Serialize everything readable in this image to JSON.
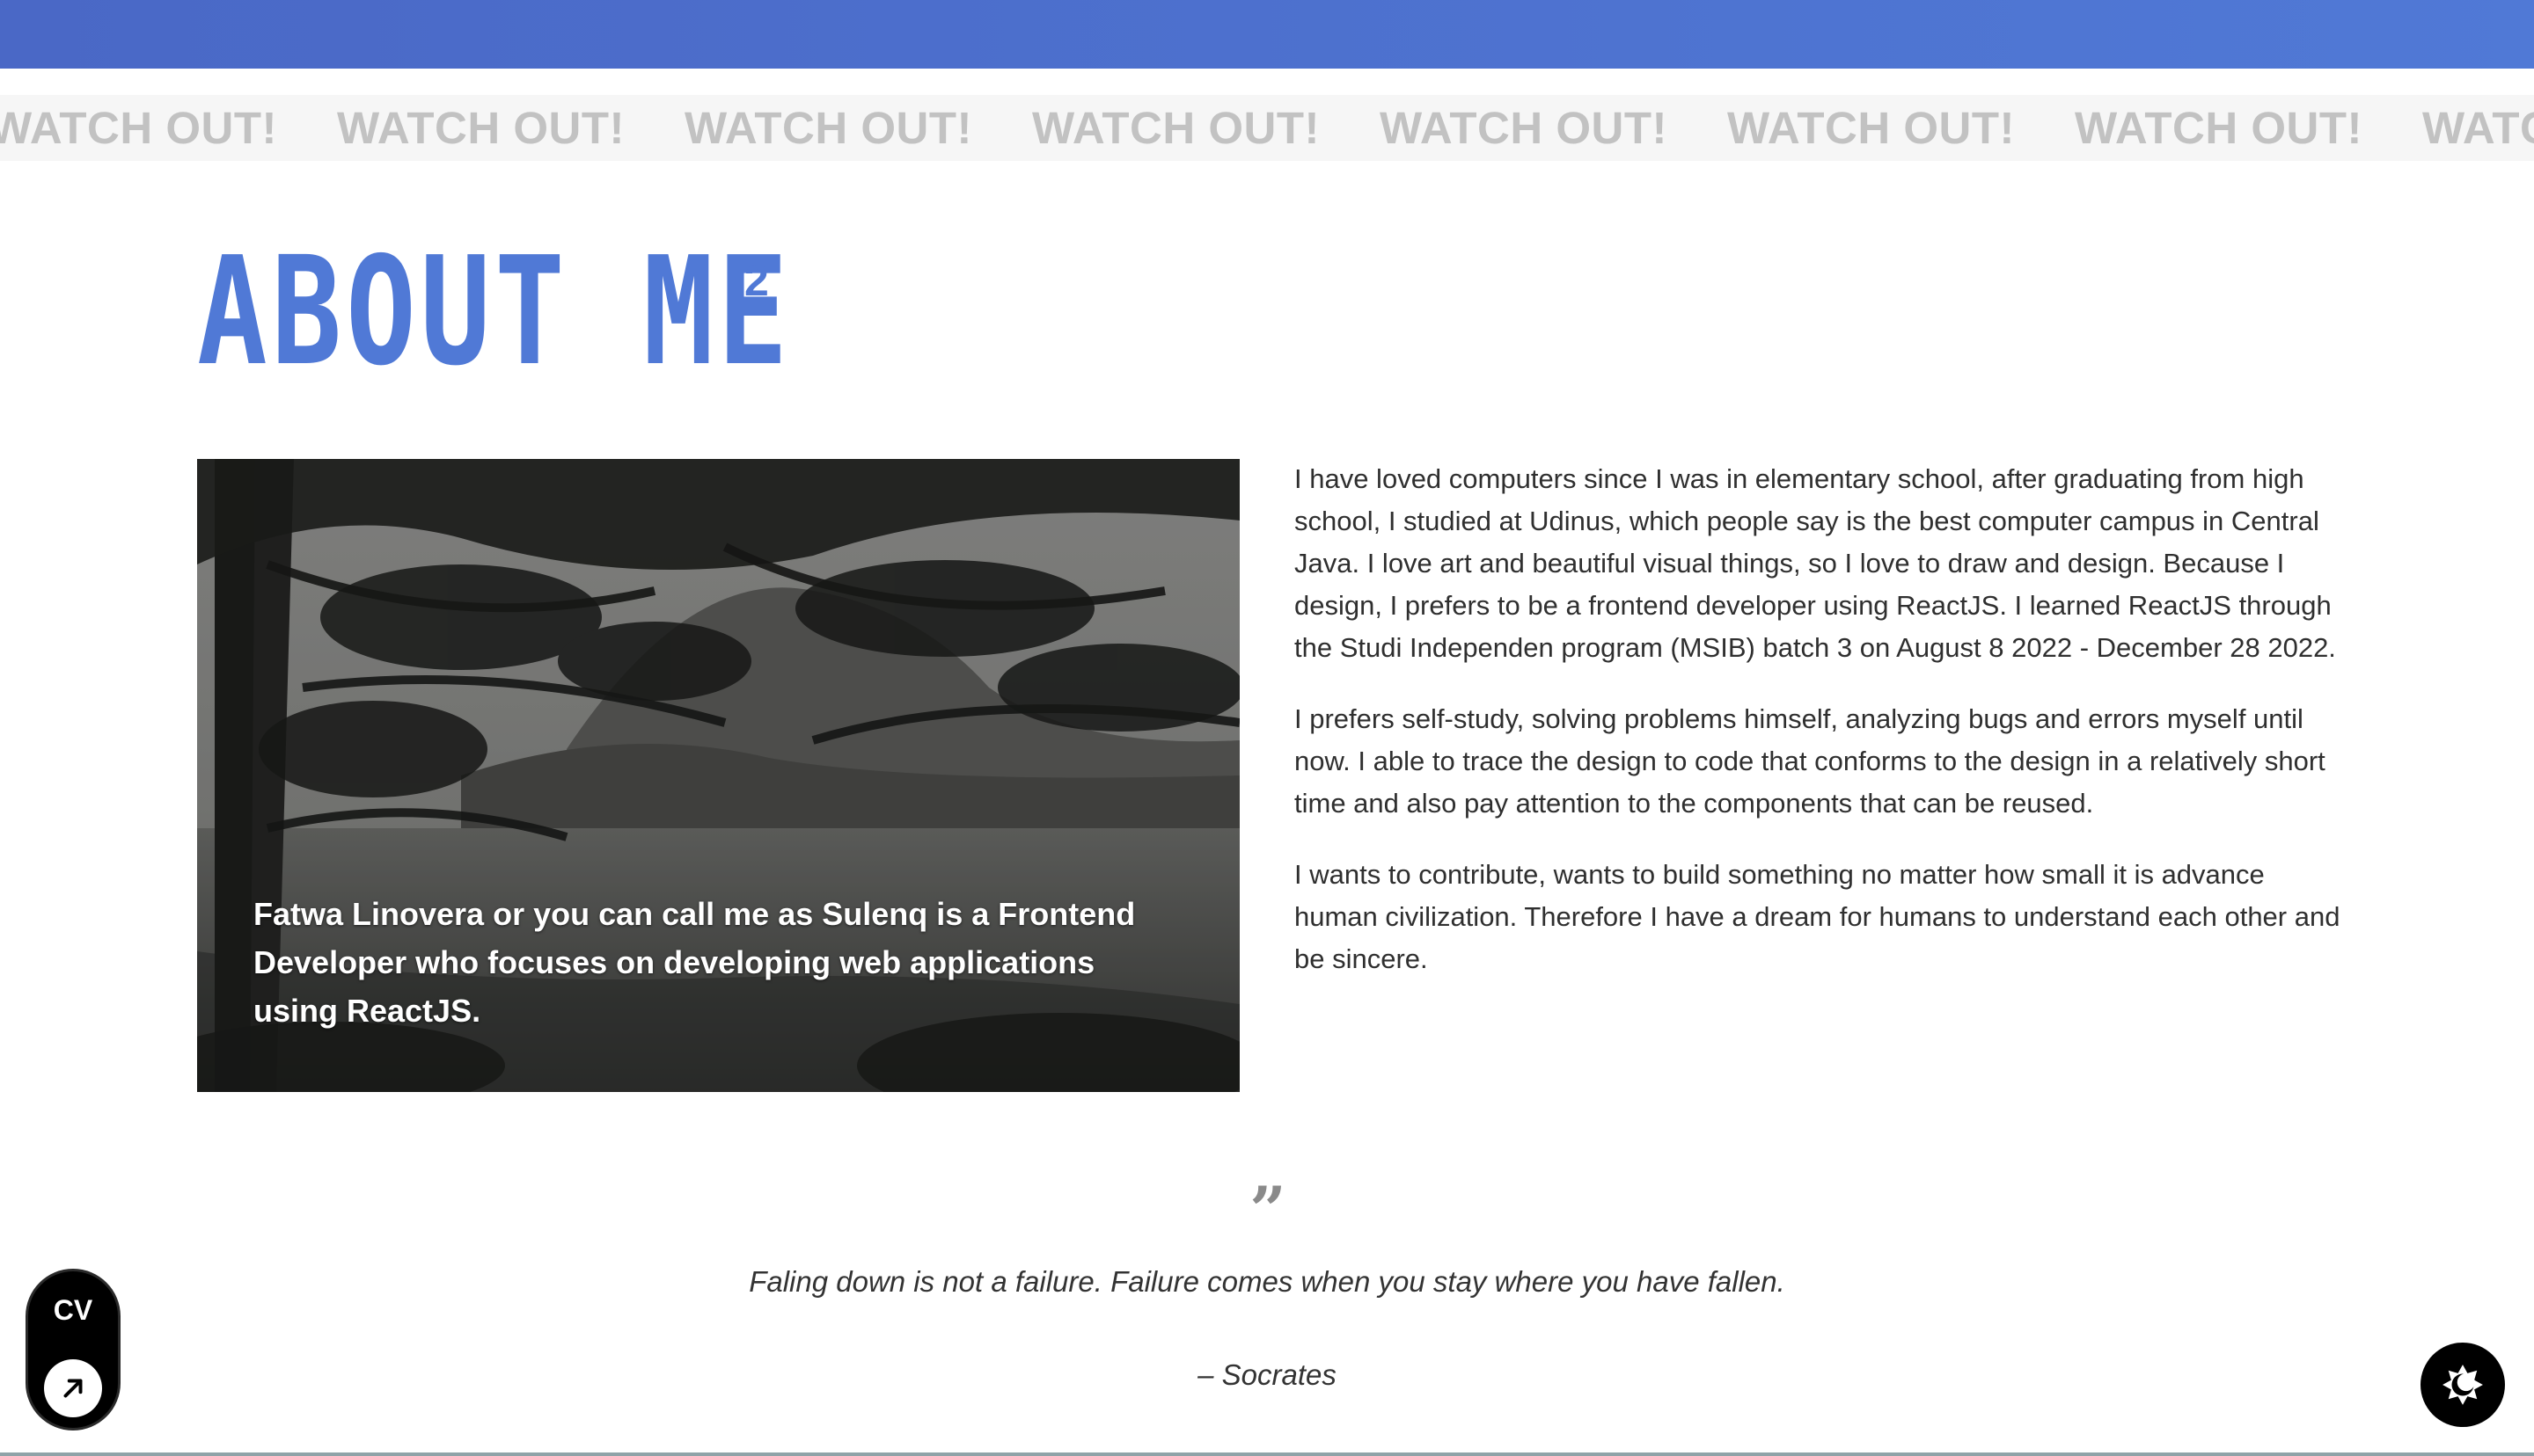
{
  "marquee": {
    "items": [
      "WATCH OUT!",
      "WATCH OUT!",
      "WATCH OUT!",
      "WATCH OUT!",
      "WATCH OUT!",
      "WATCH OUT!",
      "WATCH OUT!",
      "WATCH OUT!"
    ]
  },
  "about": {
    "title": "ABOUT ME",
    "number": "2"
  },
  "photo": {
    "caption": "Fatwa Linovera or you can call me as Sulenq is a Frontend Developer who focuses on developing web applications using ReactJS."
  },
  "bio": {
    "paragraphs": [
      "I have loved computers since I was in elementary school, after graduating from high school, I studied at Udinus, which people say is the best computer campus in Central Java. I love art and beautiful visual things, so I love to draw and design. Because I design, I prefers to be a frontend developer using ReactJS. I learned ReactJS through the Studi Independen program (MSIB) batch 3 on August 8 2022 - December 28 2022.",
      "I prefers self-study, solving problems himself, analyzing bugs and errors myself until now. I able to trace the design to code that conforms to the design in a relatively short time and also pay attention to the components that can be reused.",
      "I wants to contribute, wants to build something no matter how small it is advance human civilization. Therefore I have a dream for humans to understand each other and be sincere."
    ]
  },
  "quote": {
    "mark": "”",
    "text": "Faling down is not a failure. Failure comes when you stay where you have fallen.",
    "author": "– Socrates"
  },
  "cv_button": {
    "label": "CV",
    "icon": "arrow-up-right-icon"
  },
  "theme_toggle": {
    "icon": "sun-moon-icon"
  },
  "colors": {
    "accent": "#5079d6",
    "marquee_text": "#c2c2c2",
    "marquee_bg": "#f6f6f6"
  }
}
